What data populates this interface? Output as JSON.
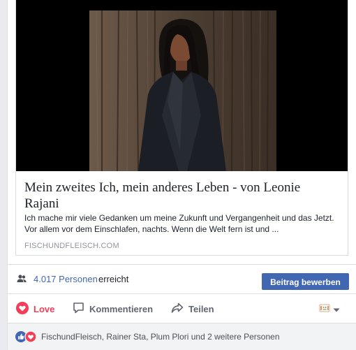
{
  "link_preview": {
    "title": "Mein zweites Ich, mein anderes Leben - von Leonie Rajani",
    "description": "Ich mache mir viele Gedanken um meine Zukunft und Vergangenheit und das Jetzt. Vor allem vor dem Einschlafen, nachts. Wenn die Welt fern ist und ...",
    "domain": "FISCHUNDFLEISCH.COM",
    "image_icon": "woman-portrait-photo"
  },
  "reach": {
    "icon": "people-icon",
    "count": "4.017 Personen",
    "suffix": "erreicht",
    "boost_label": "Beitrag bewerben"
  },
  "actions": {
    "love_label": "Love",
    "comment_label": "Kommentieren",
    "share_label": "Teilen",
    "audience_icon": "page-avatar-icon"
  },
  "reactions": {
    "icons": [
      "like-icon",
      "love-icon"
    ],
    "names": "FischundFleisch, Rainer Sta, Plum Plori und 2 weitere Personen"
  },
  "colors": {
    "brand": "#4267b2",
    "love": "#f33e58",
    "muted": "#606770",
    "domain_gray": "#90949c"
  }
}
